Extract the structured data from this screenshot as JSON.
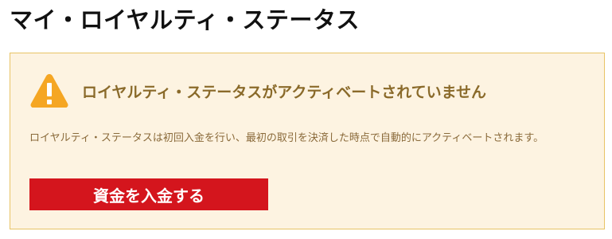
{
  "page": {
    "title": "マイ・ロイヤルティ・ステータス"
  },
  "notice": {
    "icon": "warning-icon",
    "icon_color": "#f5a623",
    "background_color": "#fdf3e1",
    "border_color": "#e8c465",
    "title": "ロイヤルティ・ステータスがアクティベートされていません",
    "body": "ロイヤルティ・ステータスは初回入金を行い、最初の取引を決済した時点で自動的にアクティベートされます。"
  },
  "actions": {
    "deposit_label": "資金を入金する",
    "deposit_color": "#d4151d"
  }
}
